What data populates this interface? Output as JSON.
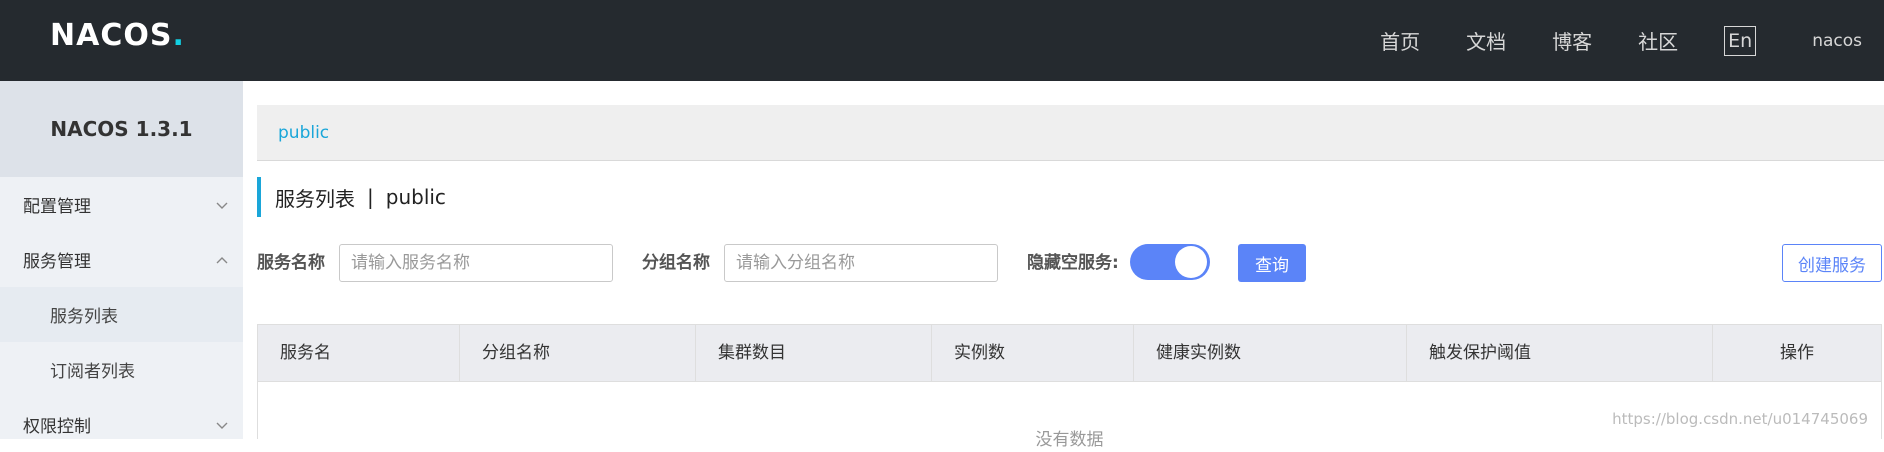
{
  "header": {
    "logo_text": "NACOS",
    "nav": [
      "首页",
      "文档",
      "博客",
      "社区"
    ],
    "lang_button": "En",
    "user": "nacos"
  },
  "sidebar": {
    "title": "NACOS 1.3.1",
    "menus": [
      {
        "label": "配置管理",
        "expanded": false
      },
      {
        "label": "服务管理",
        "expanded": true,
        "children": [
          "服务列表",
          "订阅者列表"
        ]
      },
      {
        "label": "权限控制",
        "expanded": false
      }
    ]
  },
  "main": {
    "namespace": "public",
    "title": "服务列表",
    "title_sep": "|",
    "title_ns": "public",
    "filters": {
      "service_name_label": "服务名称",
      "service_name_placeholder": "请输入服务名称",
      "group_name_label": "分组名称",
      "group_name_placeholder": "请输入分组名称",
      "hide_empty_label": "隐藏空服务:",
      "hide_empty_on": true,
      "query_button": "查询",
      "create_button": "创建服务"
    },
    "table": {
      "columns": [
        "服务名",
        "分组名称",
        "集群数目",
        "实例数",
        "健康实例数",
        "触发保护阈值",
        "操作"
      ],
      "empty_text": "没有数据"
    }
  },
  "watermark": "https://blog.csdn.net/u014745069",
  "colors": {
    "header_bg": "#252a2f",
    "accent": "#1aa6d9",
    "primary": "#5b84f8",
    "sidebar_bg": "#eef1f5"
  }
}
